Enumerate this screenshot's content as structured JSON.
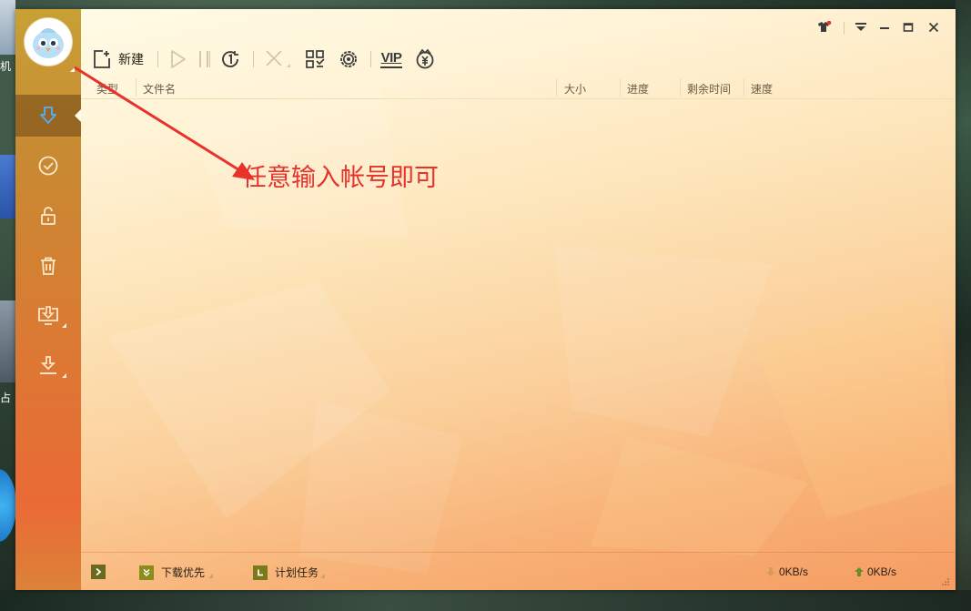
{
  "desktop": {
    "fragment_left_1": "机",
    "fragment_left_2": "占"
  },
  "sidebar": {
    "items": [
      {
        "icon": "download-arrow-icon",
        "active": true
      },
      {
        "icon": "completed-check-icon",
        "active": false
      },
      {
        "icon": "unlock-icon",
        "active": false
      },
      {
        "icon": "trash-icon",
        "active": false
      },
      {
        "icon": "monitor-download-icon",
        "active": false
      },
      {
        "icon": "download-tray-icon",
        "active": false
      }
    ]
  },
  "titlebar": {
    "buttons": [
      "skin-icon",
      "menu-dropdown-icon",
      "minimize-icon",
      "maximize-icon",
      "close-icon"
    ]
  },
  "toolbar": {
    "new_label": "新建",
    "vip_label": "VIP",
    "icons": [
      "new-task-icon",
      "start-icon",
      "pause-icon",
      "speed-limit-icon",
      "delete-icon",
      "qr-scan-icon",
      "settings-icon",
      "vip-icon",
      "money-icon"
    ]
  },
  "columns": {
    "type": "类型",
    "name": "文件名",
    "size": "大小",
    "progress": "进度",
    "remaining": "剩余时间",
    "speed": "速度"
  },
  "annotation": {
    "text": "任意输入帐号即可"
  },
  "statusbar": {
    "download_priority": "下载优先",
    "scheduled_tasks": "计划任务",
    "download_speed": "0KB/s",
    "upload_speed": "0KB/s"
  },
  "colors": {
    "annotation_red": "#e8322c",
    "sidebar_active_arrow": "#5aa8e8",
    "status_icon_olive": "#7a7a1a"
  }
}
